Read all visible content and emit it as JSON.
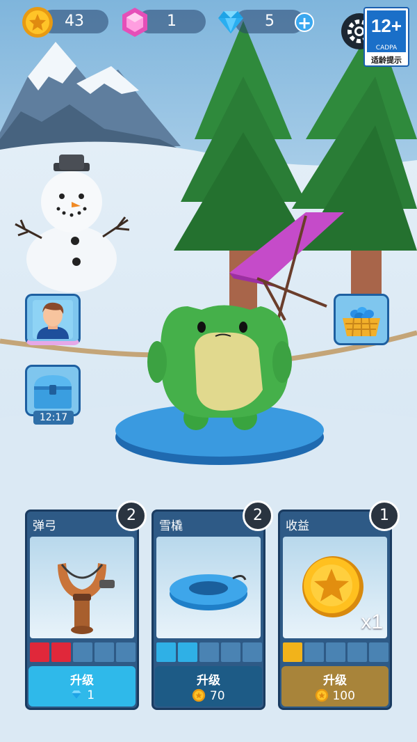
{
  "hud": {
    "coins": "43",
    "gems": "1",
    "diamonds": "5",
    "plus_symbol": "+"
  },
  "age_rating": {
    "rating": "12+",
    "org": "CADPA",
    "label": "适龄提示"
  },
  "side": {
    "chest_timer": "12:17"
  },
  "cards": [
    {
      "title": "弹弓",
      "level": "2",
      "upgrade_label": "升级",
      "cost": "1",
      "cost_icon": "diamond-icon",
      "pips_filled": 2,
      "pips_total": 5,
      "pip_color": "#e0283a",
      "button_color": "#2fb9ea"
    },
    {
      "title": "雪橇",
      "level": "2",
      "upgrade_label": "升级",
      "cost": "70",
      "cost_icon": "coin-icon",
      "pips_filled": 2,
      "pips_total": 5,
      "pip_color": "#2fb0e6",
      "button_color": "#1d5b86"
    },
    {
      "title": "收益",
      "level": "1",
      "upgrade_label": "升级",
      "cost": "100",
      "cost_icon": "coin-icon",
      "pips_filled": 1,
      "pips_total": 5,
      "pip_color": "#f2b31a",
      "button_color": "#a8843a",
      "multiplier": "x1"
    }
  ]
}
